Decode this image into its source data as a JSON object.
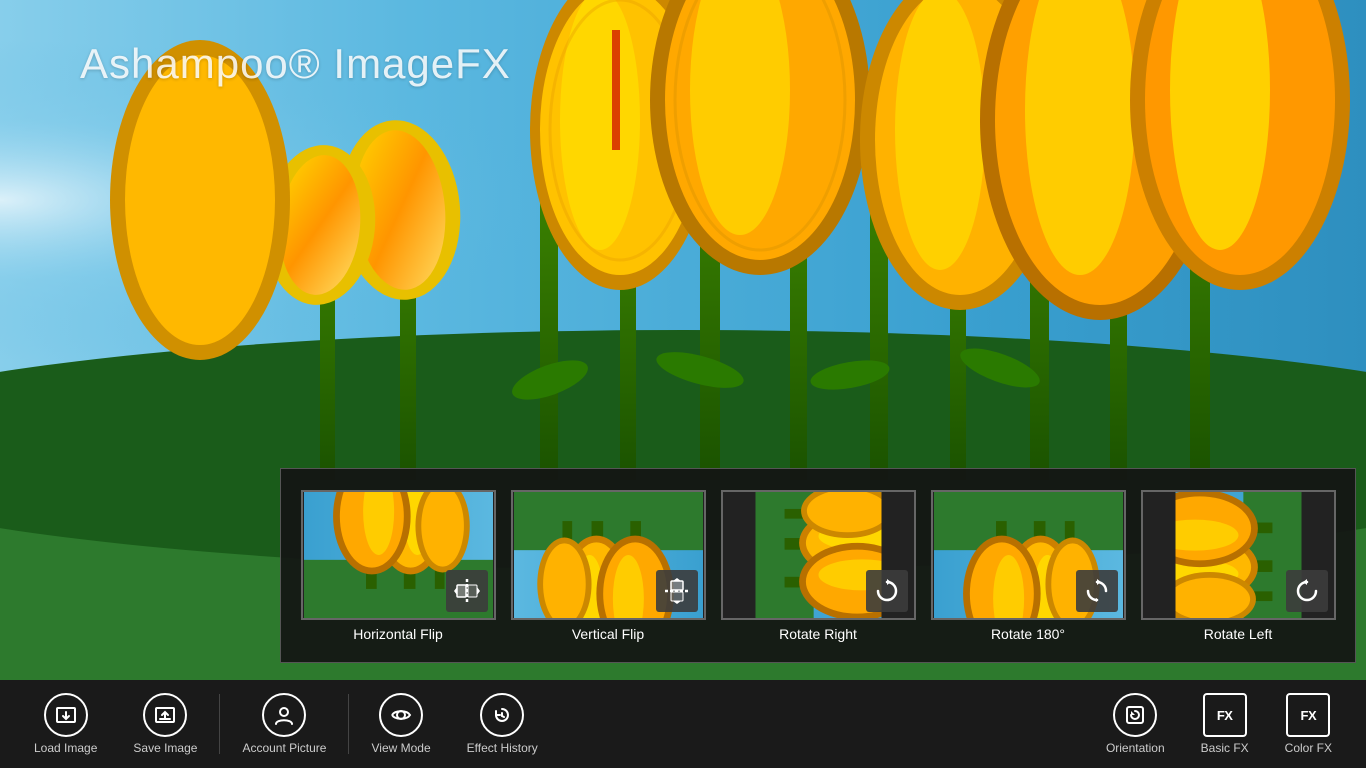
{
  "app": {
    "title": "Ashampoo® ImageFX"
  },
  "transform_panel": {
    "items": [
      {
        "id": "horizontal-flip",
        "label": "Horizontal Flip",
        "icon": "flip-h-icon",
        "rotation": 0,
        "flip": "scaleX(-1)"
      },
      {
        "id": "vertical-flip",
        "label": "Vertical Flip",
        "icon": "flip-v-icon",
        "rotation": 0,
        "flip": "scaleY(-1)"
      },
      {
        "id": "rotate-right",
        "label": "Rotate Right",
        "icon": "rotate-right-icon",
        "rotation": 90,
        "flip": "none"
      },
      {
        "id": "rotate-180",
        "label": "Rotate 180°",
        "icon": "rotate-180-icon",
        "rotation": 180,
        "flip": "none"
      },
      {
        "id": "rotate-left",
        "label": "Rotate Left",
        "icon": "rotate-left-icon",
        "rotation": -90,
        "flip": "none"
      }
    ]
  },
  "toolbar": {
    "buttons": [
      {
        "id": "load-image",
        "label": "Load Image",
        "icon": "load-icon"
      },
      {
        "id": "save-image",
        "label": "Save Image",
        "icon": "save-icon"
      },
      {
        "id": "account-picture",
        "label": "Account Picture",
        "icon": "account-icon"
      },
      {
        "id": "view-mode",
        "label": "View Mode",
        "icon": "view-icon"
      },
      {
        "id": "effect-history",
        "label": "Effect History",
        "icon": "history-icon"
      }
    ],
    "right_buttons": [
      {
        "id": "orientation",
        "label": "Orientation",
        "icon": "orientation-icon"
      },
      {
        "id": "basic-fx",
        "label": "Basic FX",
        "icon": "basic-fx-icon",
        "text": "FX"
      },
      {
        "id": "color-fx",
        "label": "Color FX",
        "icon": "color-fx-icon",
        "text": "FX"
      }
    ]
  },
  "colors": {
    "sky_blue": "#5BB8E0",
    "toolbar_bg": "#1a1a1a",
    "panel_bg": "rgba(20,20,20,0.92)",
    "tulip_yellow": "#FFD700",
    "tulip_orange": "#FFA500"
  }
}
